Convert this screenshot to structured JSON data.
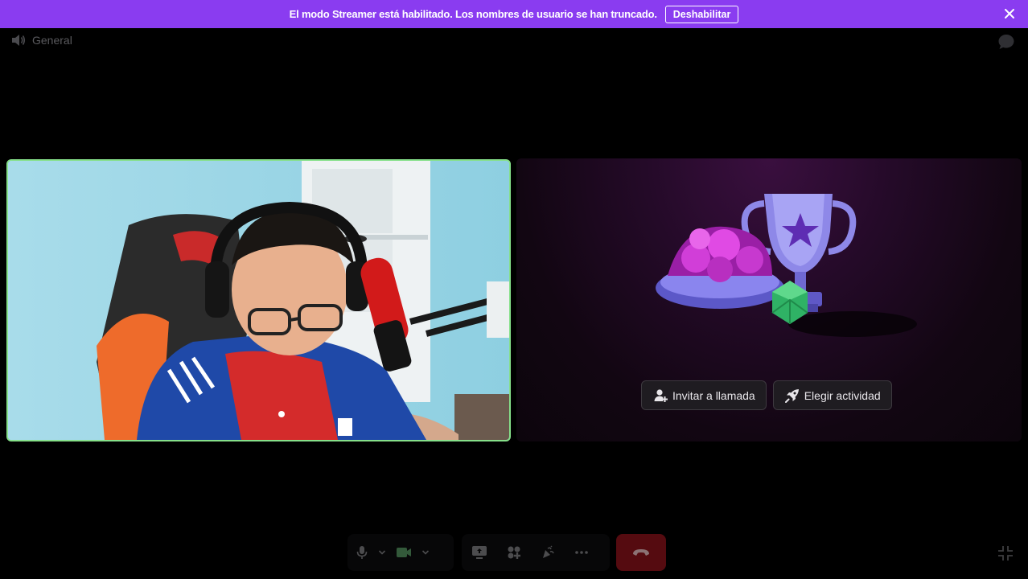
{
  "banner": {
    "message": "El modo Streamer está habilitado. Los nombres de usuario se han truncado.",
    "disable_label": "Deshabilitar",
    "color": "#8a3cf0"
  },
  "channel": {
    "name": "General",
    "icon": "speaker-icon"
  },
  "tiles": {
    "camera": {
      "speaking_border_color": "#86e08a",
      "content": "webcam-video"
    },
    "empty": {
      "invite_label": "Invitar a llamada",
      "invite_icon": "add-person-icon",
      "activity_label": "Elegir actividad",
      "activity_icon": "rocket-icon"
    }
  },
  "controls": {
    "items": [
      "microphone-icon",
      "chevron-down-icon",
      "camera-icon",
      "chevron-down-icon",
      "screen-share-icon",
      "activities-icon",
      "soundboard-icon",
      "more-icon",
      "end-call-icon"
    ],
    "end_call_color": "#7a1117"
  }
}
